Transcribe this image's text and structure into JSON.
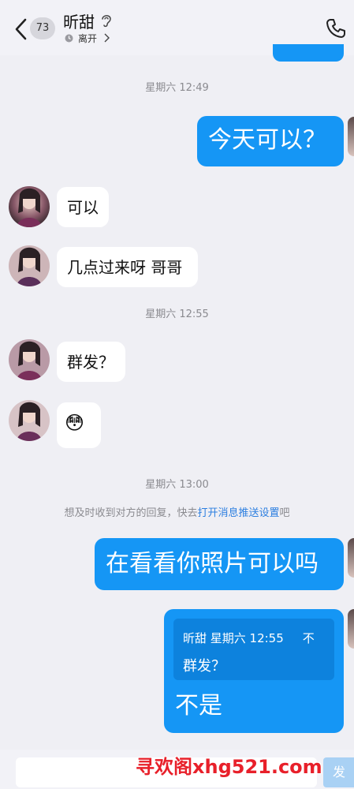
{
  "header": {
    "unread_count": "73",
    "contact_name": "昕甜",
    "status": "离开"
  },
  "messages": {
    "time1": "星期六 12:49",
    "out1": "今天可以？",
    "in1": "可以",
    "in2": "几点过来呀 哥哥",
    "time2": "星期六 12:55",
    "in3": "群发？",
    "in4_emoji": "😳",
    "time3": "星期六 13:00",
    "notice_prefix": "想及时收到对方的回复，快去",
    "notice_link": "打开消息推送设置",
    "notice_suffix": "吧",
    "out2": "在看看你照片可以吗",
    "quote_header": "昕甜 星期六 12:55",
    "quote_tail": "不",
    "quote_body": "群发？",
    "out3": "不是"
  },
  "input": {
    "send_label": "发"
  },
  "watermark": "寻欢阁xhg521.com",
  "colors": {
    "accent": "#1596f5",
    "background": "#efeff4",
    "link": "#2d7fe0"
  }
}
